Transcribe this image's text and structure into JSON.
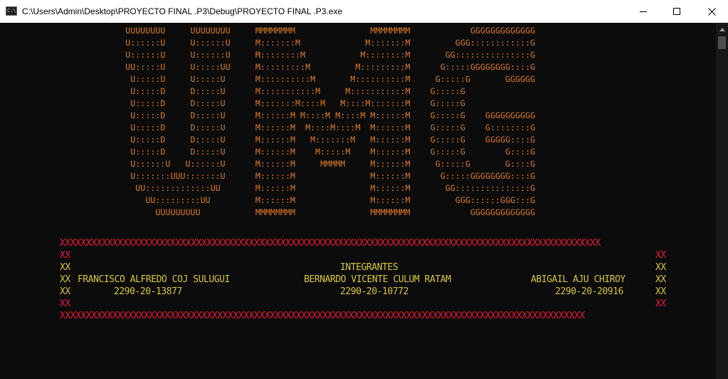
{
  "window": {
    "title": "C:\\Users\\Admin\\Desktop\\PROYECTO FINAL .P3\\Debug\\PROYECTO FINAL .P3.exe",
    "icon": "console-app-icon",
    "icon_label": "C:\\",
    "controls": [
      "minimize-icon",
      "maximize-icon",
      "close-icon"
    ]
  },
  "colors": {
    "background": "#0c0c0c",
    "ascii_art": "#e07b28",
    "border": "#e8183a",
    "text": "#d9c43a"
  },
  "ascii_art": [
    "          UUUUUUUU     UUUUUUUU     MMMMMMMM               MMMMMMMM            GGGGGGGGGGGGG",
    "          U::::::U     U::::::U     M:::::::M             M:::::::M         GGG::::::::::::G",
    "          U::::::U     U::::::U     M::::::::M           M::::::::M       GG:::::::::::::::G",
    "          UU:::::U     U:::::UU     M:::::::::M         M:::::::::M      G:::::GGGGGGGG::::G",
    "           U:::::U     U:::::U      M::::::::::M       M::::::::::M     G:::::G       GGGGGG",
    "           U:::::D     D:::::U      M:::::::::::M     M:::::::::::M    G:::::G",
    "           U:::::D     D:::::U      M:::::::M::::M   M::::M:::::::M    G:::::G",
    "           U:::::D     D:::::U      M::::::M M::::M M::::M M::::::M    G:::::G    GGGGGGGGGG",
    "           U:::::D     D:::::U      M::::::M  M::::M::::M  M::::::M    G:::::G    G::::::::G",
    "           U:::::D     D:::::U      M::::::M   M:::::::M   M::::::M    G:::::G    GGGGG::::G",
    "           U:::::D     D:::::U      M::::::M    M:::::M    M::::::M    G:::::G        G::::G",
    "           U::::::U   U::::::U      M::::::M     MMMMM     M::::::M     G:::::G       G::::G",
    "           U:::::::UUU:::::::U      M::::::M               M::::::M      G:::::GGGGGGGG::::G",
    "            UU:::::::::::::UU       M::::::M               M::::::M       GG:::::::::::::::G",
    "              UU:::::::::UU         M::::::M               M::::::M         GGG::::::GGG:::G",
    "                UUUUUUUUU           MMMMMMMM               MMMMMMMM            GGGGGGGGGGGGG"
  ],
  "credits_box": {
    "border_top": "XXXXXXXXXXXXXXXXXXXXXXXXXXXXXXXXXXXXXXXXXXXXXXXXXXXXXXXXXXXXXXXXXXXXXXXXXXXXXXXXXXXXXXXXXXXXXXXXXXXXXXX",
    "side_left": "XX",
    "side_right": "XX",
    "heading": "INTEGRANTES",
    "members": [
      {
        "name": "FRANCISCO ALFREDO COJ SULUGUI",
        "id": "2290-20-13877"
      },
      {
        "name": "BERNARDO VICENTE CULUM RATAM",
        "id": "2290-20-10772"
      },
      {
        "name": "ABIGAIL AJU CHIROY",
        "id": "2290-20-20916"
      }
    ],
    "border_bottom": "XXXXXXXXXXXXXXXXXXXXXXXXXXXXXXXXXXXXXXXXXXXXXXXXXXXXXXXXXXXXXXXXXXXXXXXXXXXXXXXXXXXXXXXXXXXXXXXXXXXX"
  }
}
